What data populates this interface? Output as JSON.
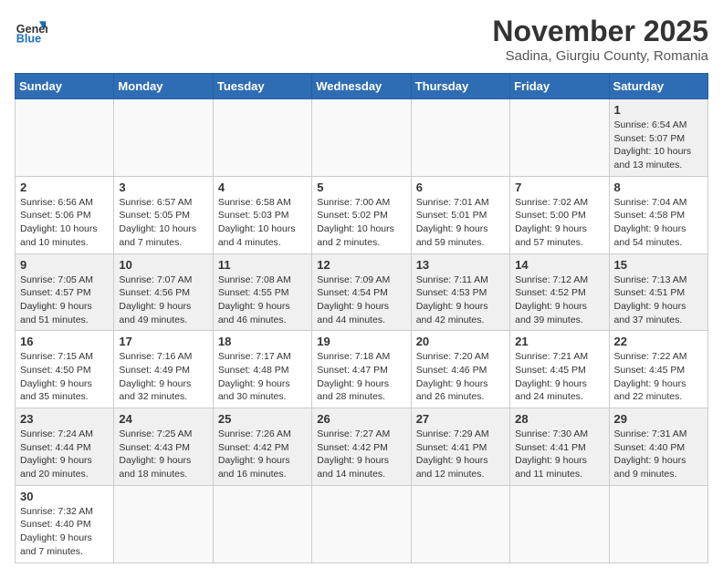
{
  "header": {
    "logo_general": "General",
    "logo_blue": "Blue",
    "month_title": "November 2025",
    "subtitle": "Sadina, Giurgiu County, Romania"
  },
  "days_of_week": [
    "Sunday",
    "Monday",
    "Tuesday",
    "Wednesday",
    "Thursday",
    "Friday",
    "Saturday"
  ],
  "weeks": [
    [
      {
        "day": "",
        "info": ""
      },
      {
        "day": "",
        "info": ""
      },
      {
        "day": "",
        "info": ""
      },
      {
        "day": "",
        "info": ""
      },
      {
        "day": "",
        "info": ""
      },
      {
        "day": "",
        "info": ""
      },
      {
        "day": "1",
        "info": "Sunrise: 6:54 AM\nSunset: 5:07 PM\nDaylight: 10 hours\nand 13 minutes."
      }
    ],
    [
      {
        "day": "2",
        "info": "Sunrise: 6:56 AM\nSunset: 5:06 PM\nDaylight: 10 hours\nand 10 minutes."
      },
      {
        "day": "3",
        "info": "Sunrise: 6:57 AM\nSunset: 5:05 PM\nDaylight: 10 hours\nand 7 minutes."
      },
      {
        "day": "4",
        "info": "Sunrise: 6:58 AM\nSunset: 5:03 PM\nDaylight: 10 hours\nand 4 minutes."
      },
      {
        "day": "5",
        "info": "Sunrise: 7:00 AM\nSunset: 5:02 PM\nDaylight: 10 hours\nand 2 minutes."
      },
      {
        "day": "6",
        "info": "Sunrise: 7:01 AM\nSunset: 5:01 PM\nDaylight: 9 hours\nand 59 minutes."
      },
      {
        "day": "7",
        "info": "Sunrise: 7:02 AM\nSunset: 5:00 PM\nDaylight: 9 hours\nand 57 minutes."
      },
      {
        "day": "8",
        "info": "Sunrise: 7:04 AM\nSunset: 4:58 PM\nDaylight: 9 hours\nand 54 minutes."
      }
    ],
    [
      {
        "day": "9",
        "info": "Sunrise: 7:05 AM\nSunset: 4:57 PM\nDaylight: 9 hours\nand 51 minutes."
      },
      {
        "day": "10",
        "info": "Sunrise: 7:07 AM\nSunset: 4:56 PM\nDaylight: 9 hours\nand 49 minutes."
      },
      {
        "day": "11",
        "info": "Sunrise: 7:08 AM\nSunset: 4:55 PM\nDaylight: 9 hours\nand 46 minutes."
      },
      {
        "day": "12",
        "info": "Sunrise: 7:09 AM\nSunset: 4:54 PM\nDaylight: 9 hours\nand 44 minutes."
      },
      {
        "day": "13",
        "info": "Sunrise: 7:11 AM\nSunset: 4:53 PM\nDaylight: 9 hours\nand 42 minutes."
      },
      {
        "day": "14",
        "info": "Sunrise: 7:12 AM\nSunset: 4:52 PM\nDaylight: 9 hours\nand 39 minutes."
      },
      {
        "day": "15",
        "info": "Sunrise: 7:13 AM\nSunset: 4:51 PM\nDaylight: 9 hours\nand 37 minutes."
      }
    ],
    [
      {
        "day": "16",
        "info": "Sunrise: 7:15 AM\nSunset: 4:50 PM\nDaylight: 9 hours\nand 35 minutes."
      },
      {
        "day": "17",
        "info": "Sunrise: 7:16 AM\nSunset: 4:49 PM\nDaylight: 9 hours\nand 32 minutes."
      },
      {
        "day": "18",
        "info": "Sunrise: 7:17 AM\nSunset: 4:48 PM\nDaylight: 9 hours\nand 30 minutes."
      },
      {
        "day": "19",
        "info": "Sunrise: 7:18 AM\nSunset: 4:47 PM\nDaylight: 9 hours\nand 28 minutes."
      },
      {
        "day": "20",
        "info": "Sunrise: 7:20 AM\nSunset: 4:46 PM\nDaylight: 9 hours\nand 26 minutes."
      },
      {
        "day": "21",
        "info": "Sunrise: 7:21 AM\nSunset: 4:45 PM\nDaylight: 9 hours\nand 24 minutes."
      },
      {
        "day": "22",
        "info": "Sunrise: 7:22 AM\nSunset: 4:45 PM\nDaylight: 9 hours\nand 22 minutes."
      }
    ],
    [
      {
        "day": "23",
        "info": "Sunrise: 7:24 AM\nSunset: 4:44 PM\nDaylight: 9 hours\nand 20 minutes."
      },
      {
        "day": "24",
        "info": "Sunrise: 7:25 AM\nSunset: 4:43 PM\nDaylight: 9 hours\nand 18 minutes."
      },
      {
        "day": "25",
        "info": "Sunrise: 7:26 AM\nSunset: 4:42 PM\nDaylight: 9 hours\nand 16 minutes."
      },
      {
        "day": "26",
        "info": "Sunrise: 7:27 AM\nSunset: 4:42 PM\nDaylight: 9 hours\nand 14 minutes."
      },
      {
        "day": "27",
        "info": "Sunrise: 7:29 AM\nSunset: 4:41 PM\nDaylight: 9 hours\nand 12 minutes."
      },
      {
        "day": "28",
        "info": "Sunrise: 7:30 AM\nSunset: 4:41 PM\nDaylight: 9 hours\nand 11 minutes."
      },
      {
        "day": "29",
        "info": "Sunrise: 7:31 AM\nSunset: 4:40 PM\nDaylight: 9 hours\nand 9 minutes."
      }
    ],
    [
      {
        "day": "30",
        "info": "Sunrise: 7:32 AM\nSunset: 4:40 PM\nDaylight: 9 hours\nand 7 minutes."
      },
      {
        "day": "",
        "info": ""
      },
      {
        "day": "",
        "info": ""
      },
      {
        "day": "",
        "info": ""
      },
      {
        "day": "",
        "info": ""
      },
      {
        "day": "",
        "info": ""
      },
      {
        "day": "",
        "info": ""
      }
    ]
  ]
}
